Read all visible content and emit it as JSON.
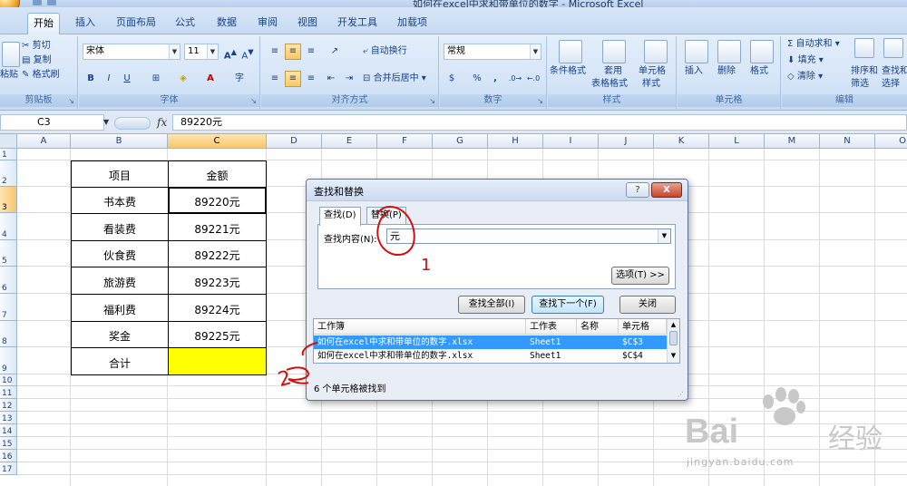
{
  "window": {
    "title": "如何在excel中求和带单位的数字 - Microsoft Excel"
  },
  "ribbon_tabs": [
    "开始",
    "插入",
    "页面布局",
    "公式",
    "数据",
    "审阅",
    "视图",
    "开发工具",
    "加载项"
  ],
  "ribbon": {
    "clipboard": {
      "paste": "粘贴",
      "cut": "剪切",
      "copy": "复制",
      "format_painter": "格式刷",
      "group": "剪贴板"
    },
    "font": {
      "name": "宋体",
      "size": "11",
      "bold": "B",
      "italic": "I",
      "underline": "U",
      "grow": "A",
      "shrink": "A",
      "group": "字体"
    },
    "alignment": {
      "wrap": "自动换行",
      "merge": "合并后居中",
      "group": "对齐方式"
    },
    "number": {
      "format": "常规",
      "currency": "$",
      "percent": "%",
      "comma": ",",
      "group": "数字"
    },
    "styles": {
      "conditional": "条件格式",
      "table1": "套用",
      "table2": "表格格式",
      "cell1": "单元格",
      "cell2": "样式",
      "group": "样式"
    },
    "cells": {
      "insert": "插入",
      "delete": "删除",
      "format": "格式",
      "group": "单元格"
    },
    "editing": {
      "autosum": "自动求和",
      "fill": "填充",
      "clear": "清除",
      "sort1": "排序和",
      "sort2": "筛选",
      "find1": "查找和",
      "find2": "选择",
      "group": "编辑"
    }
  },
  "formula_bar": {
    "name_box": "C3",
    "fx": "fx",
    "formula": "89220元"
  },
  "columns": [
    "A",
    "B",
    "C",
    "D",
    "E",
    "F",
    "G",
    "H",
    "I",
    "J",
    "K",
    "L",
    "M",
    "N",
    "O"
  ],
  "rows": [
    "1",
    "2",
    "3",
    "4",
    "5",
    "6",
    "7",
    "8",
    "9",
    "10",
    "11",
    "12",
    "13",
    "14",
    "15",
    "16",
    "17"
  ],
  "table": {
    "header": [
      "项目",
      "金额"
    ],
    "rows": [
      [
        "书本费",
        "89220元"
      ],
      [
        "看装费",
        "89221元"
      ],
      [
        "伙食费",
        "89222元"
      ],
      [
        "旅游费",
        "89223元"
      ],
      [
        "福利费",
        "89224元"
      ],
      [
        "奖金",
        "89225元"
      ],
      [
        "合计",
        ""
      ]
    ],
    "total_fill": "#ffff00"
  },
  "dialog": {
    "title": "查找和替换",
    "help_button": "?",
    "close_button": "X",
    "tab_find": "查找(D)",
    "tab_replace": "替换(P)",
    "find_label": "查找内容(N):",
    "find_value": "元",
    "options_button": "选项(T) >>",
    "find_all_button": "查找全部(I)",
    "find_next_button": "查找下一个(F)",
    "close_label": "关闭",
    "result_headers": [
      "工作簿",
      "工作表",
      "名称",
      "单元格"
    ],
    "results": [
      [
        "如何在excel中求和带单位的数字.xlsx",
        "Sheet1",
        "",
        "$C$3"
      ],
      [
        "如何在excel中求和带单位的数字.xlsx",
        "Sheet1",
        "",
        "$C$4"
      ]
    ],
    "status": "6 个单元格被找到"
  },
  "annotations": {
    "one": "1",
    "two": "2"
  },
  "watermark": {
    "brand": "Bai",
    "brand2": "经验",
    "url": "jingyan.baidu.com"
  },
  "colors": {
    "accent": "#15428b",
    "selection": "#3399ff",
    "annotation": "#d01010"
  }
}
